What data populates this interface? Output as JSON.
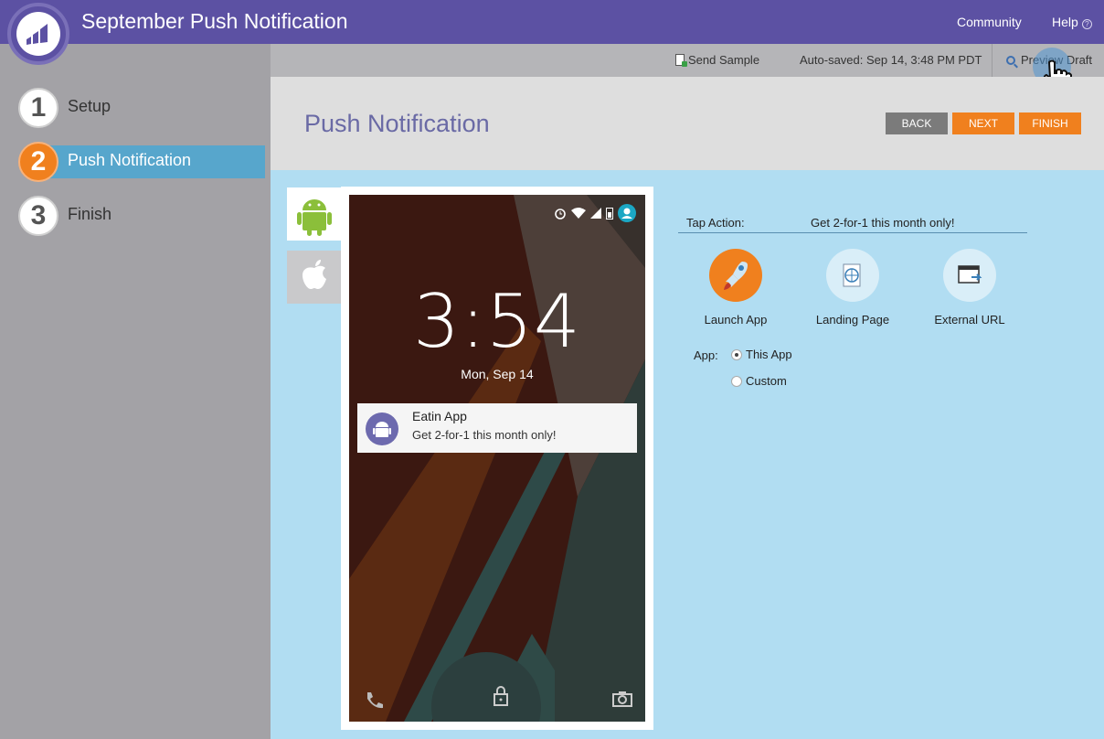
{
  "header": {
    "title": "September Push Notification",
    "community": "Community",
    "help": "Help"
  },
  "steps": [
    {
      "num": "1",
      "label": "Setup"
    },
    {
      "num": "2",
      "label": "Push Notification"
    },
    {
      "num": "3",
      "label": "Finish"
    }
  ],
  "toolbar": {
    "send_sample": "Send Sample",
    "autosaved": "Auto-saved: Sep 14, 3:48 PM PDT",
    "preview": "Preview Draft"
  },
  "page": {
    "title": "Push Notification",
    "back": "BACK",
    "next": "NEXT",
    "finish": "FINISH"
  },
  "phone": {
    "time": "3:54",
    "date": "Mon, Sep 14",
    "notification": {
      "app": "Eatin App",
      "message": "Get 2-for-1 this month only!"
    }
  },
  "tap_action": {
    "label": "Tap Action:",
    "value": "Get 2-for-1 this month only!",
    "options": [
      "Launch App",
      "Landing Page",
      "External URL"
    ],
    "app_label": "App:",
    "radio": [
      "This App",
      "Custom"
    ]
  },
  "colors": {
    "brand": "#5c51a3",
    "accent": "#f0801e",
    "active_step": "#57a6cc",
    "content_bg": "#b1ddf2"
  }
}
